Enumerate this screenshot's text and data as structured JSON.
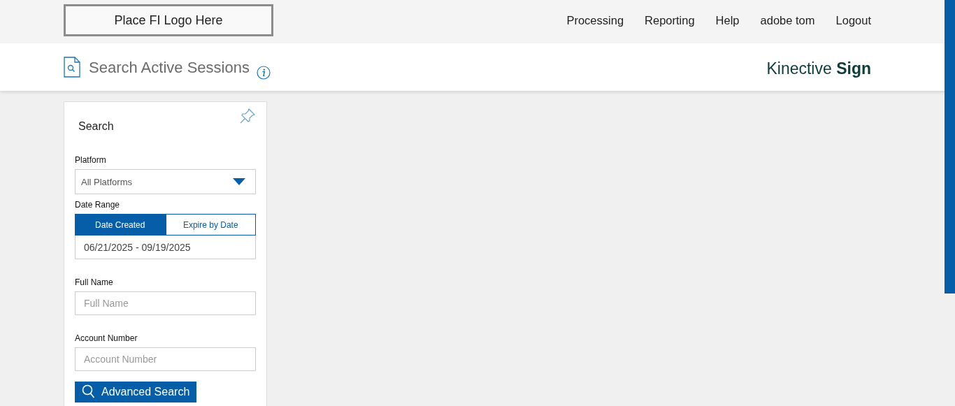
{
  "logo": {
    "text": "Place FI Logo Here"
  },
  "nav": [
    {
      "label": "Processing"
    },
    {
      "label": "Reporting"
    },
    {
      "label": "Help"
    },
    {
      "label": "adobe tom"
    },
    {
      "label": "Logout"
    }
  ],
  "page_title": "Search Active Sessions",
  "brand": "Kinective **Sign**",
  "search_panel": {
    "title": "Search",
    "platform": {
      "label": "Platform",
      "value": "All Platforms"
    },
    "date_range": {
      "label": "Date Range",
      "tabs": [
        {
          "label": "Date Created",
          "selected": true
        },
        {
          "label": "Expire by Date",
          "selected": false
        }
      ],
      "value": "06/21/2025 - 09/19/2025"
    },
    "full_name": {
      "label": "Full Name",
      "placeholder": "Full Name"
    },
    "account_number": {
      "label": "Account Number",
      "placeholder": "Account Number"
    },
    "button": "Advanced Search"
  }
}
